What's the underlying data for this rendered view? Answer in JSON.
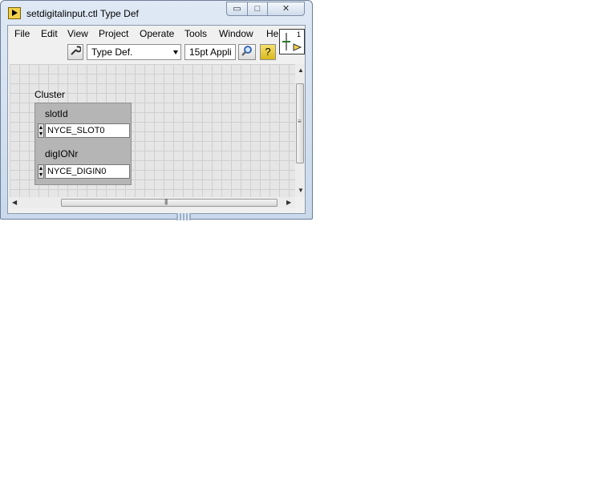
{
  "window": {
    "title": "setdigitalinput.ctl Type Def",
    "controls": {
      "minimize": "▭",
      "maximize": "□",
      "close": "✕"
    }
  },
  "menu": {
    "items": [
      "File",
      "Edit",
      "View",
      "Project",
      "Operate",
      "Tools",
      "Window",
      "He"
    ]
  },
  "toolbar": {
    "type_def_dropdown": "Type Def.",
    "font_dropdown": "15pt Appli",
    "icons": [
      "wrench-icon",
      "search-icon",
      "help-icon"
    ]
  },
  "front_panel": {
    "cluster": {
      "label": "Cluster",
      "fields": [
        {
          "label": "slotId",
          "value": "NYCE_SLOT0"
        },
        {
          "label": "digIONr",
          "value": "NYCE_DIGIN0"
        }
      ]
    }
  },
  "vi_icon": {
    "connector_text": "1"
  },
  "colors": {
    "panel_grid": "#e6e6e6",
    "cluster_bg": "#b5b5b5",
    "titlebar": "#dfe9f5"
  }
}
